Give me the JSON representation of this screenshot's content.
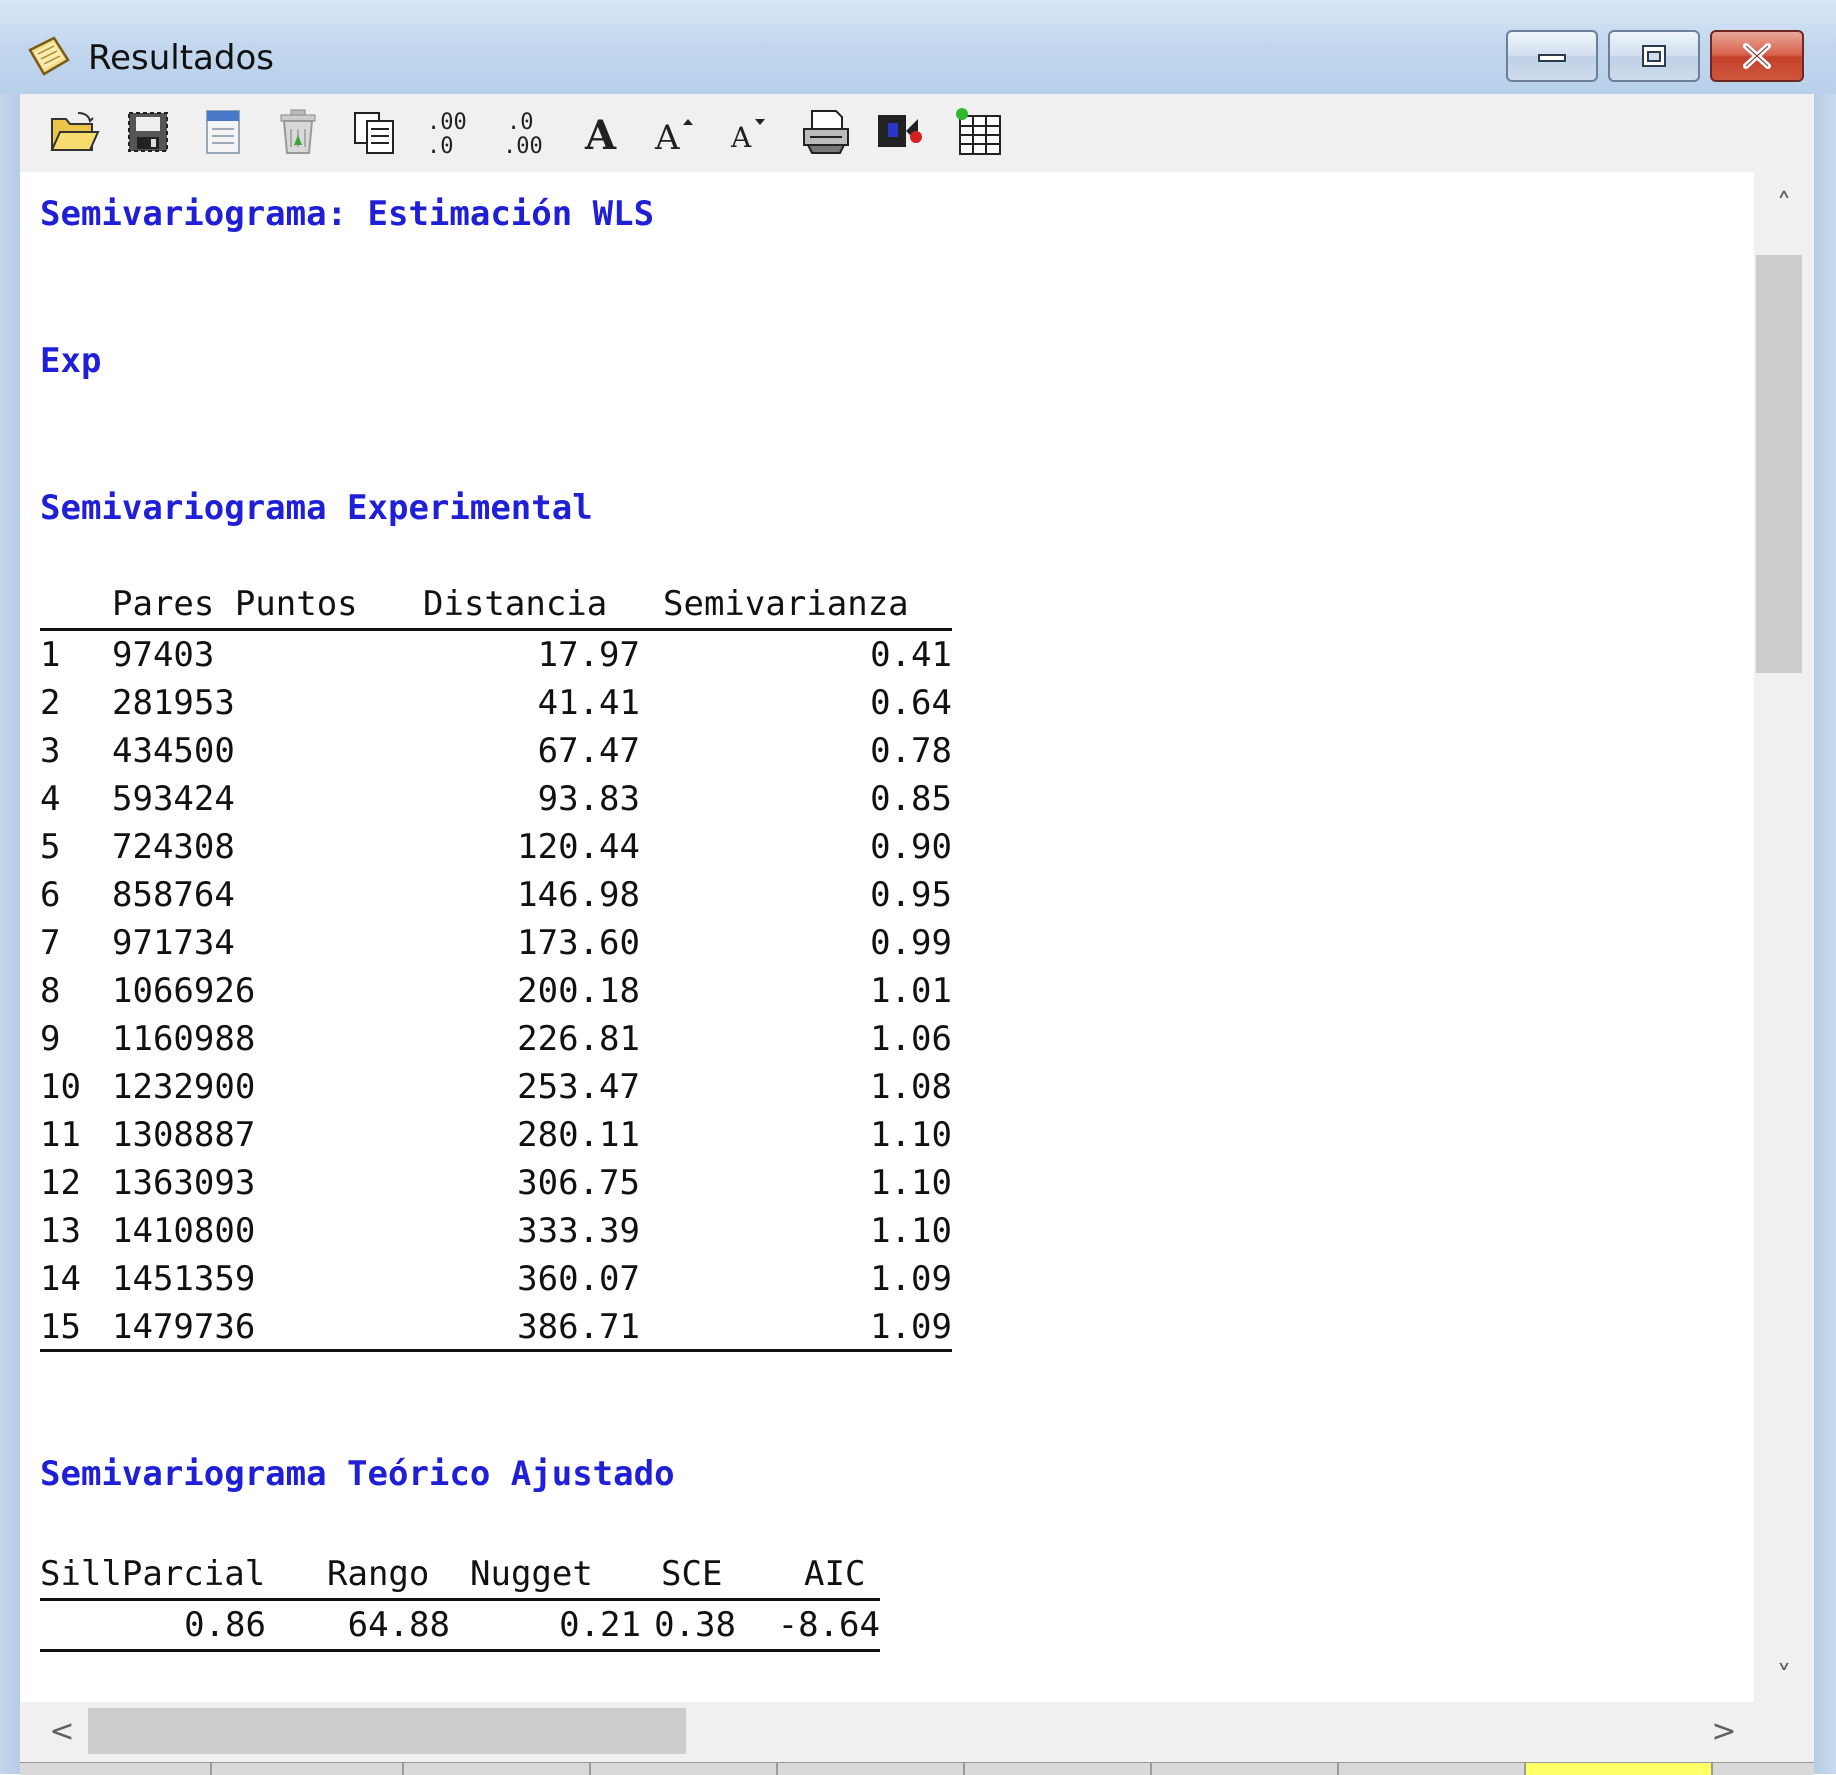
{
  "window": {
    "title": "Resultados",
    "minimize_symbol": "–",
    "maximize_symbol": "□",
    "close_symbol": "✕"
  },
  "toolbar": {
    "items": [
      {
        "icon": "open-folder-icon"
      },
      {
        "icon": "save-icon"
      },
      {
        "icon": "document-icon"
      },
      {
        "icon": "trash-icon"
      },
      {
        "icon": "copy-icon"
      },
      {
        "icon": "increase-decimals-icon",
        "label": ".00\n.0"
      },
      {
        "icon": "decrease-decimals-icon",
        "label": ".0\n.00"
      },
      {
        "icon": "bold-font-icon",
        "label": "A"
      },
      {
        "icon": "font-increase-icon",
        "label": "A"
      },
      {
        "icon": "font-decrease-icon",
        "label": "A"
      },
      {
        "icon": "print-icon"
      },
      {
        "icon": "record-icon"
      },
      {
        "icon": "table-grid-icon"
      }
    ]
  },
  "content": {
    "title": "Semivariograma: Estimación WLS",
    "model": "Exp",
    "experimental": {
      "heading": "Semivariograma Experimental",
      "headers": [
        "",
        "Pares Puntos",
        "Distancia",
        "Semivarianza"
      ],
      "rows": [
        [
          "1",
          "97403",
          "17.97",
          "0.41"
        ],
        [
          "2",
          "281953",
          "41.41",
          "0.64"
        ],
        [
          "3",
          "434500",
          "67.47",
          "0.78"
        ],
        [
          "4",
          "593424",
          "93.83",
          "0.85"
        ],
        [
          "5",
          "724308",
          "120.44",
          "0.90"
        ],
        [
          "6",
          "858764",
          "146.98",
          "0.95"
        ],
        [
          "7",
          "971734",
          "173.60",
          "0.99"
        ],
        [
          "8",
          "1066926",
          "200.18",
          "1.01"
        ],
        [
          "9",
          "1160988",
          "226.81",
          "1.06"
        ],
        [
          "10",
          "1232900",
          "253.47",
          "1.08"
        ],
        [
          "11",
          "1308887",
          "280.11",
          "1.10"
        ],
        [
          "12",
          "1363093",
          "306.75",
          "1.10"
        ],
        [
          "13",
          "1410800",
          "333.39",
          "1.10"
        ],
        [
          "14",
          "1451359",
          "360.07",
          "1.09"
        ],
        [
          "15",
          "1479736",
          "386.71",
          "1.09"
        ]
      ]
    },
    "theoretical": {
      "heading": "Semivariograma Teórico Ajustado",
      "headers": [
        "SillParcial",
        "Rango",
        "Nugget",
        "SCE",
        "AIC"
      ],
      "row": [
        "0.86",
        "64.88",
        "0.21",
        "0.38",
        "-8.64"
      ]
    }
  },
  "scrollbars": {
    "up_arrow": "˄",
    "down_arrow": "˅",
    "left_arrow": "<",
    "right_arrow": ">"
  },
  "colors": {
    "heading_text": "#1f1fd8",
    "title_bar": "#c2d7ee",
    "close_button": "#c4412b",
    "status_highlight": "#ffff66"
  }
}
